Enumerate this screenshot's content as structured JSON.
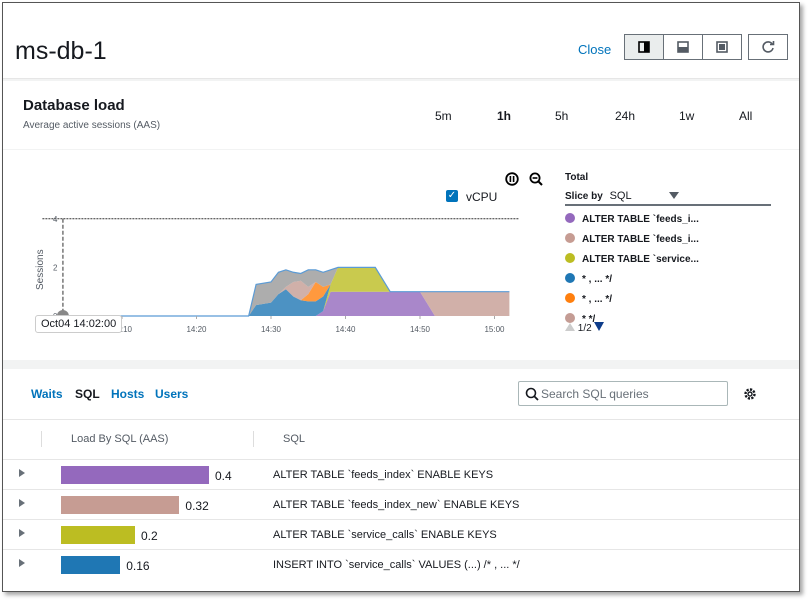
{
  "header": {
    "title": "ms-db-1",
    "close_label": "Close",
    "view_icons": [
      "split-right-icon",
      "split-bottom-icon",
      "full-screen-icon"
    ],
    "refresh_icon": "refresh-icon"
  },
  "load": {
    "title": "Database load",
    "subtitle": "Average active sessions (AAS)",
    "ranges": [
      "5m",
      "1h",
      "5h",
      "24h",
      "1w",
      "All"
    ],
    "selected_range": "1h"
  },
  "chart_controls": {
    "pause_icon": "pause-icon",
    "zoom_out_icon": "zoom-out-icon",
    "vcpu_label": "vCPU",
    "vcpu_checked": true,
    "tooltip": "Oct04 14:02:00"
  },
  "legend": {
    "total": "Total",
    "slice_by_label": "Slice by",
    "slice_by_value": "SQL",
    "page": "1/2",
    "items": [
      {
        "label": "ALTER TABLE `feeds_i...",
        "color": "#9469bd"
      },
      {
        "label": "ALTER TABLE `feeds_i...",
        "color": "#c69c93"
      },
      {
        "label": "ALTER TABLE `service...",
        "color": "#bcbd22"
      },
      {
        "label": "* , ... */",
        "color": "#1f77b4"
      },
      {
        "label": "* , ... */",
        "color": "#ff7f0e"
      },
      {
        "label": "*      */",
        "color": "#c49c94"
      }
    ]
  },
  "chart_data": {
    "type": "area",
    "stacked": true,
    "ylabel": "Sessions",
    "yticks": [
      0,
      2,
      4
    ],
    "ylim": [
      0,
      4.4
    ],
    "vcpu_line": 4,
    "xticks": [
      "14:10",
      "14:20",
      "14:30",
      "14:40",
      "14:50",
      "15:00"
    ],
    "x": [
      "14:02",
      "14:27",
      "14:28",
      "14:30",
      "14:31",
      "14:32",
      "14:33",
      "14:34",
      "14:35",
      "14:36",
      "14:37",
      "14:38",
      "14:39",
      "14:44",
      "14:46",
      "14:50",
      "14:52",
      "15:02"
    ],
    "series": [
      {
        "color": "#9469bd",
        "values": [
          0,
          0,
          0,
          0,
          0,
          0,
          0,
          0,
          0,
          0,
          0.2,
          1.0,
          1.0,
          1.0,
          1.0,
          1.0,
          0,
          0
        ]
      },
      {
        "color": "#c69c93",
        "values": [
          0,
          0,
          0,
          0,
          0,
          0,
          0,
          0,
          0,
          0,
          0,
          0,
          0,
          0,
          0,
          0,
          1.0,
          1.0
        ]
      },
      {
        "color": "#bcbd22",
        "values": [
          0,
          0,
          0,
          0,
          0,
          0,
          0,
          0,
          0,
          0,
          0,
          0.3,
          1.0,
          1.0,
          0,
          0,
          0,
          0
        ]
      },
      {
        "color": "#1f77b4",
        "values": [
          0,
          0,
          0.45,
          0.55,
          0.9,
          1.1,
          0.8,
          0.65,
          0.6,
          0.6,
          0.6,
          0,
          0,
          0,
          0,
          0,
          0,
          0
        ]
      },
      {
        "color": "#ff7f0e",
        "values": [
          0,
          0,
          0,
          0,
          0,
          0,
          0,
          0,
          0.3,
          0.8,
          0.4,
          0,
          0,
          0,
          0,
          0,
          0,
          0
        ]
      },
      {
        "color": "#c49c94",
        "values": [
          0,
          0,
          0,
          0,
          0,
          0.1,
          0.6,
          0.8,
          0.3,
          0,
          0,
          0,
          0,
          0,
          0,
          0,
          0,
          0
        ]
      },
      {
        "color": "#999999",
        "values": [
          0,
          0,
          0.85,
          0.85,
          0.9,
          0.7,
          0.4,
          0.3,
          0.7,
          0.5,
          0.6,
          0.6,
          0,
          0,
          0,
          0,
          0,
          0
        ]
      }
    ]
  },
  "tabs": [
    "Waits",
    "SQL",
    "Hosts",
    "Users"
  ],
  "active_tab": "SQL",
  "search": {
    "placeholder": "Search SQL queries"
  },
  "settings_icon": "gear-icon",
  "table": {
    "columns": [
      "Load By SQL (AAS)",
      "SQL"
    ],
    "rows": [
      {
        "value": "0.4",
        "load": 0.4,
        "color": "#9469bd",
        "sql": "ALTER TABLE `feeds_index` ENABLE KEYS"
      },
      {
        "value": "0.32",
        "load": 0.32,
        "color": "#c69c93",
        "sql": "ALTER TABLE `feeds_index_new` ENABLE KEYS"
      },
      {
        "value": "0.2",
        "load": 0.2,
        "color": "#bcbd22",
        "sql": "ALTER TABLE `service_calls` ENABLE KEYS"
      },
      {
        "value": "0.16",
        "load": 0.16,
        "color": "#1f77b4",
        "sql": "INSERT INTO `service_calls` VALUES (...) /* , ... */"
      }
    ]
  }
}
